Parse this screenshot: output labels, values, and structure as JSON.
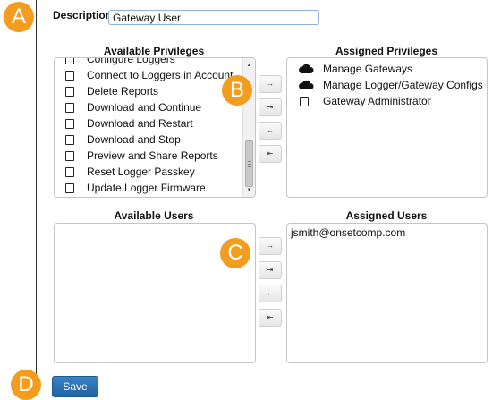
{
  "description": {
    "label": "Description:",
    "value": "Gateway User"
  },
  "available_privileges": {
    "header": "Available Privileges",
    "items": [
      "Configure Loggers",
      "Connect to Loggers in Account",
      "Delete Reports",
      "Download and Continue",
      "Download and Restart",
      "Download and Stop",
      "Preview and Share Reports",
      "Reset Logger Passkey",
      "Update Logger Firmware"
    ]
  },
  "assigned_privileges": {
    "header": "Assigned Privileges",
    "items": [
      {
        "label": "Manage Gateways",
        "icon": "cloud-icon"
      },
      {
        "label": "Manage Logger/Gateway Configs",
        "icon": "cloud-icon"
      },
      {
        "label": "Gateway Administrator",
        "icon": "checkbox"
      }
    ]
  },
  "available_users": {
    "header": "Available Users",
    "items": []
  },
  "assigned_users": {
    "header": "Assigned Users",
    "items": [
      "jsmith@onsetcomp.com"
    ]
  },
  "move_buttons": {
    "add": "→",
    "add_all": "⇥",
    "remove": "←",
    "remove_all": "⇤"
  },
  "markers": {
    "a": "A",
    "b": "B",
    "c": "C",
    "d": "D"
  },
  "save_label": "Save",
  "colors": {
    "marker": "#f39c1e",
    "save_button": "#2a72b5",
    "input_border": "#8db2e3"
  }
}
